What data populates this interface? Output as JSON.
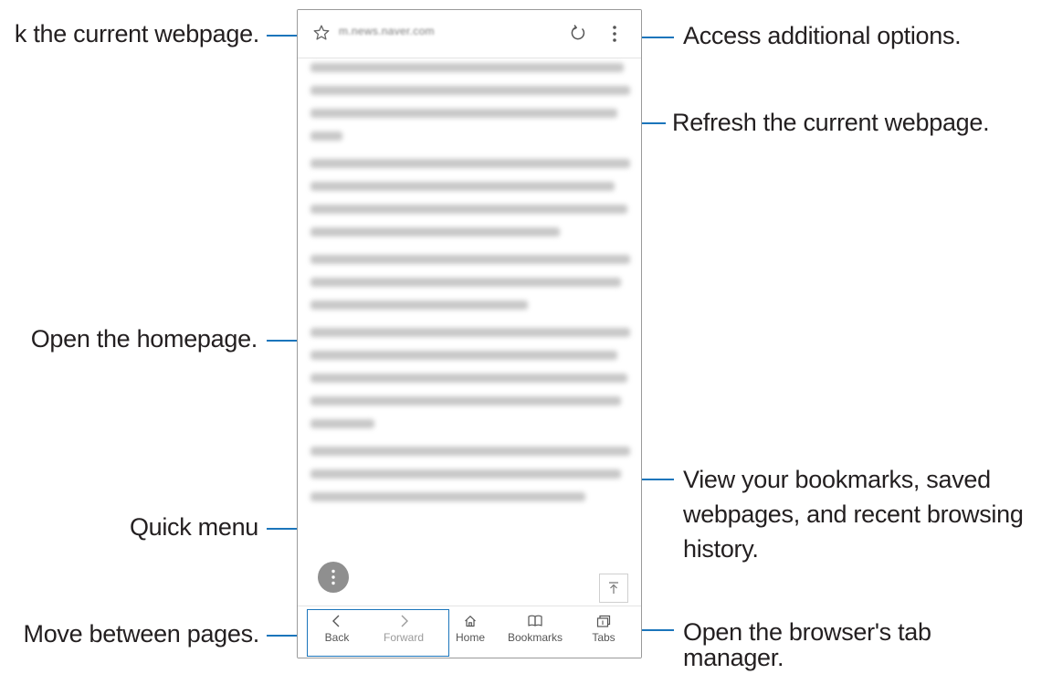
{
  "browser": {
    "url": "m.news.naver.com",
    "nav": {
      "back": "Back",
      "forward": "Forward",
      "home": "Home",
      "bookmarks": "Bookmarks",
      "tabs": "Tabs"
    }
  },
  "callouts": {
    "bookmark": "k the current webpage.",
    "more_options": "Access additional options.",
    "refresh": "Refresh the current webpage.",
    "homepage": "Open the homepage.",
    "bookmarks_view_1": "View your bookmarks, saved",
    "bookmarks_view_2": "webpages, and recent browsing",
    "bookmarks_view_3": "history.",
    "quick_menu": "Quick menu",
    "move_pages": "Move between pages.",
    "tab_manager_1": "Open the browser's tab",
    "tab_manager_2": "manager."
  },
  "icons": {
    "bookmark": "star-outline-icon",
    "refresh": "refresh-icon",
    "more": "vertical-dots-icon",
    "back": "chevron-left-icon",
    "forward": "chevron-right-icon",
    "home": "home-icon",
    "bookmarks": "book-icon",
    "tabs": "tabs-icon",
    "quick_menu": "vertical-dots-icon",
    "scroll_top": "arrow-up-to-line-icon"
  },
  "colors": {
    "leader_line": "#1b75bb",
    "callout_text": "#231f20",
    "quick_menu_bg": "#8f8f8f"
  }
}
